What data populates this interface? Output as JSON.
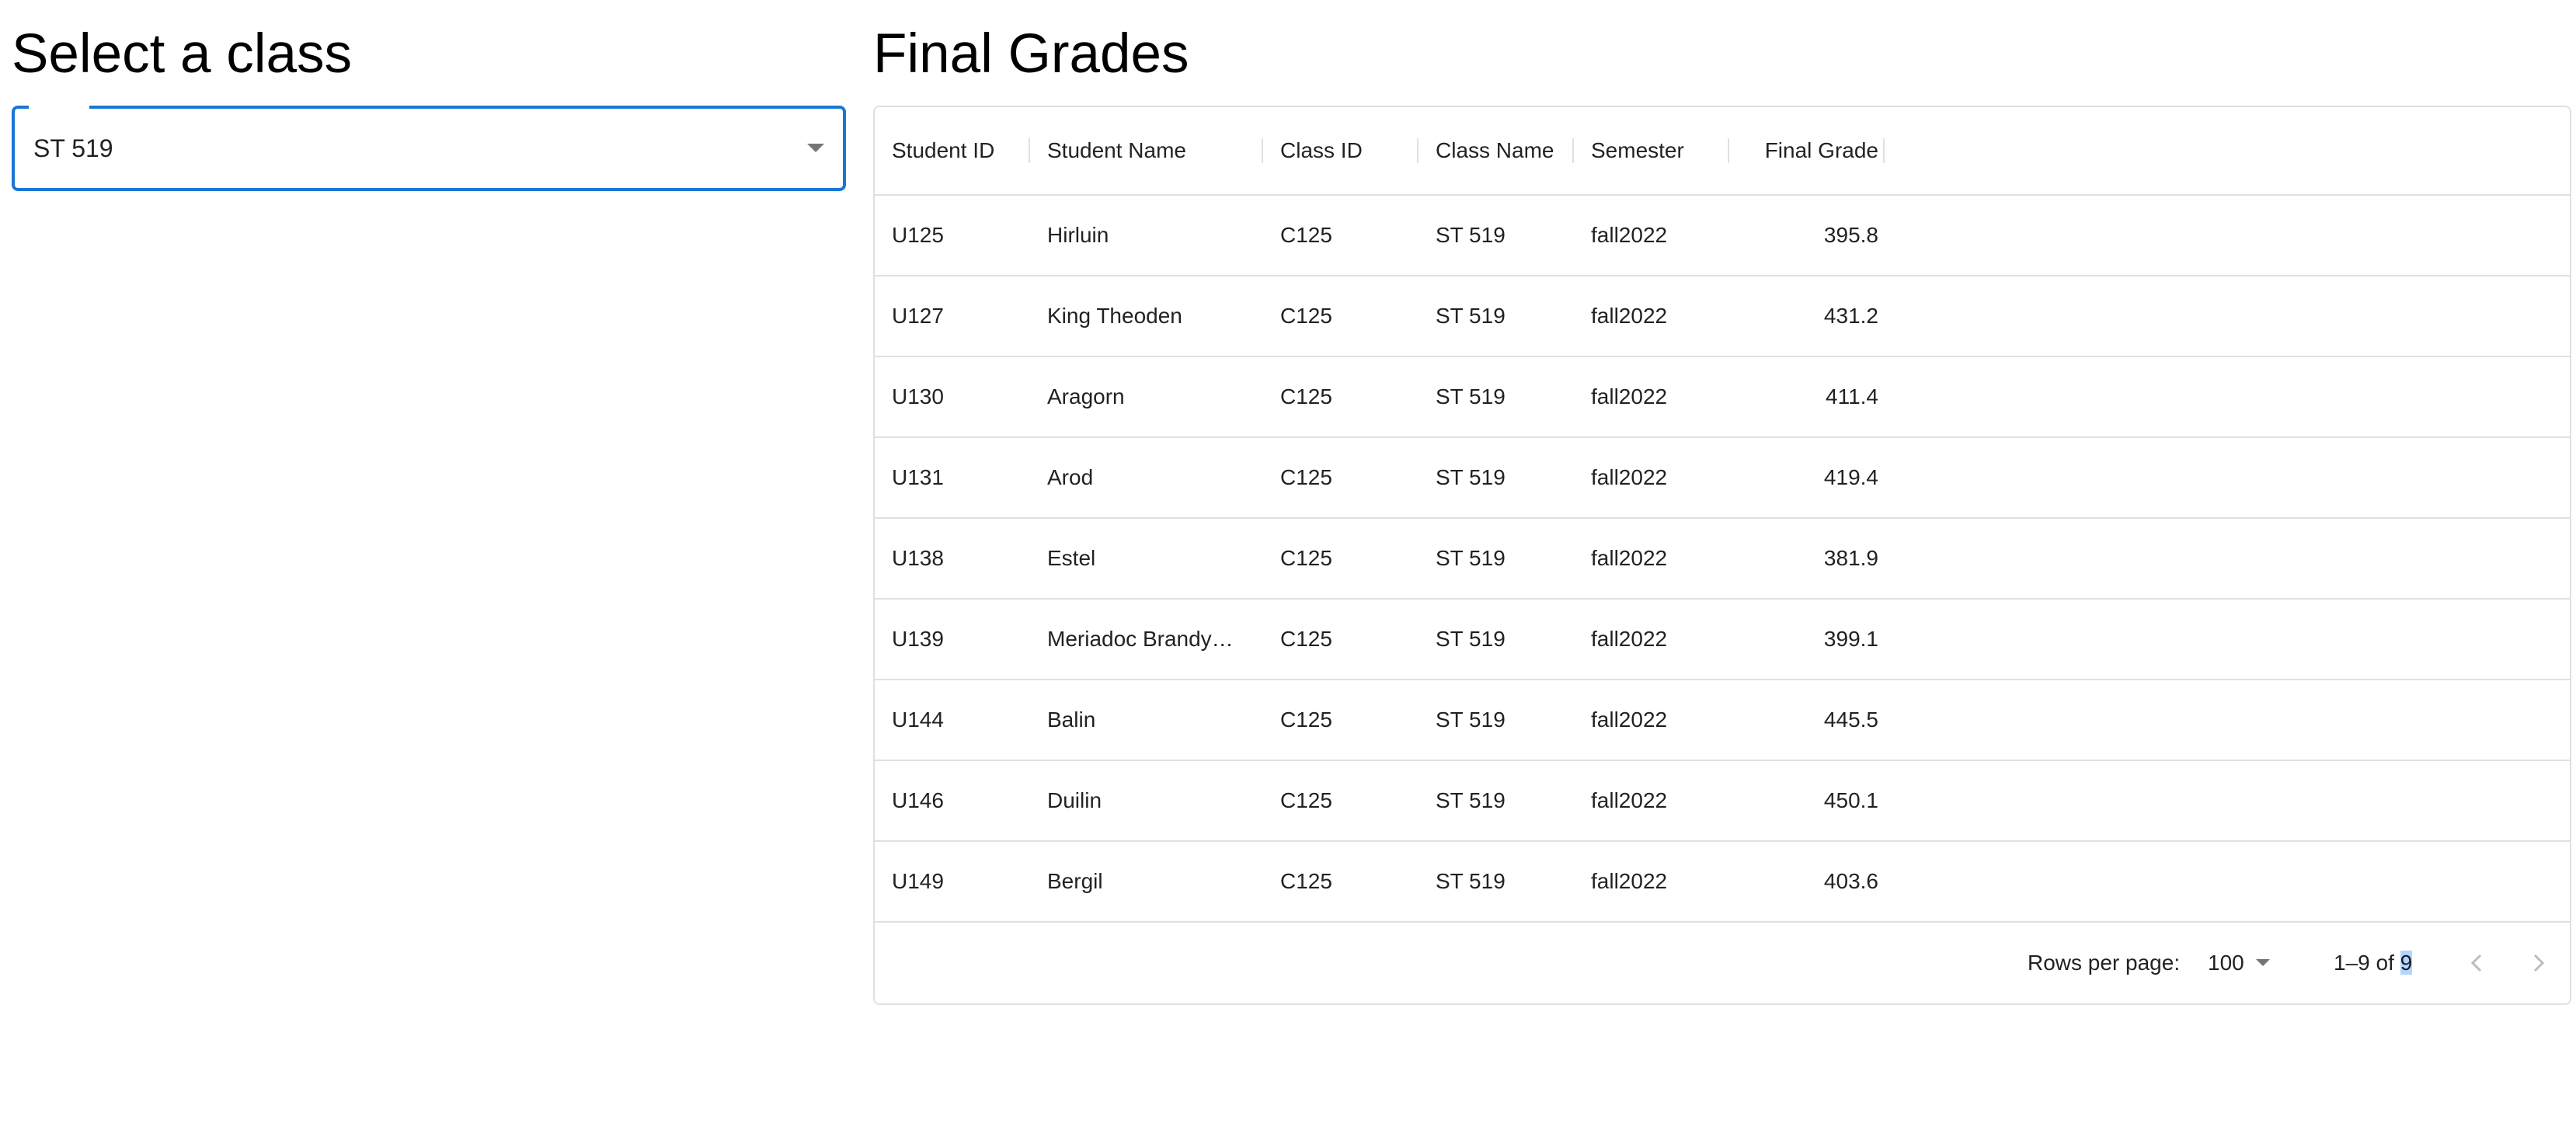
{
  "left": {
    "title": "Select a class",
    "select": {
      "value": "ST 519",
      "arrow_icon": "arrow-drop-down-icon"
    }
  },
  "right": {
    "title": "Final Grades"
  },
  "table": {
    "columns": [
      "Student ID",
      "Student Name",
      "Class ID",
      "Class Name",
      "Semester",
      "Final Grade"
    ],
    "rows": [
      {
        "student_id": "U125",
        "student_name": "Hirluin",
        "class_id": "C125",
        "class_name": "ST 519",
        "semester": "fall2022",
        "final_grade": "395.8"
      },
      {
        "student_id": "U127",
        "student_name": "King Theoden",
        "class_id": "C125",
        "class_name": "ST 519",
        "semester": "fall2022",
        "final_grade": "431.2"
      },
      {
        "student_id": "U130",
        "student_name": "Aragorn",
        "class_id": "C125",
        "class_name": "ST 519",
        "semester": "fall2022",
        "final_grade": "411.4"
      },
      {
        "student_id": "U131",
        "student_name": "Arod",
        "class_id": "C125",
        "class_name": "ST 519",
        "semester": "fall2022",
        "final_grade": "419.4"
      },
      {
        "student_id": "U138",
        "student_name": "Estel",
        "class_id": "C125",
        "class_name": "ST 519",
        "semester": "fall2022",
        "final_grade": "381.9"
      },
      {
        "student_id": "U139",
        "student_name": "Meriadoc Brandy…",
        "class_id": "C125",
        "class_name": "ST 519",
        "semester": "fall2022",
        "final_grade": "399.1"
      },
      {
        "student_id": "U144",
        "student_name": "Balin",
        "class_id": "C125",
        "class_name": "ST 519",
        "semester": "fall2022",
        "final_grade": "445.5"
      },
      {
        "student_id": "U146",
        "student_name": "Duilin",
        "class_id": "C125",
        "class_name": "ST 519",
        "semester": "fall2022",
        "final_grade": "450.1"
      },
      {
        "student_id": "U149",
        "student_name": "Bergil",
        "class_id": "C125",
        "class_name": "ST 519",
        "semester": "fall2022",
        "final_grade": "403.6"
      }
    ]
  },
  "pagination": {
    "rows_per_page_label": "Rows per page:",
    "rows_per_page_value": "100",
    "range_prefix": "1–9 of ",
    "range_total": "9",
    "prev_icon": "chevron-left-icon",
    "next_icon": "chevron-right-icon"
  },
  "colors": {
    "accent": "#1976d2",
    "border": "#e0e0e0",
    "selection": "#b4d5fe"
  }
}
